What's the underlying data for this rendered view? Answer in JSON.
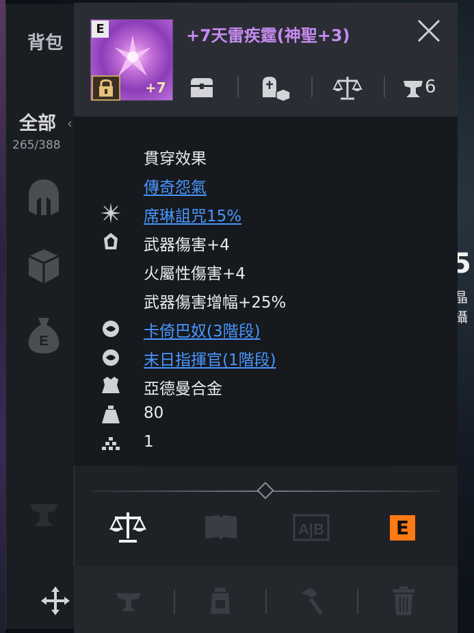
{
  "background": {
    "right_digit": "5",
    "right_text": "晶攝"
  },
  "bag": {
    "title": "背包",
    "filter_label": "全部",
    "capacity": "265/388"
  },
  "item": {
    "grade_badge": "E",
    "enhance_level": "+7",
    "name": "+7天雷疾霆(神聖+3)",
    "header_count": "6",
    "name_color": "#c78bf2"
  },
  "stats": [
    {
      "icon": "",
      "text": "貫穿效果",
      "link": false
    },
    {
      "icon": "",
      "text": "傳奇怨氣",
      "link": true
    },
    {
      "icon": "sparkle-icon",
      "text": "席琳詛咒15%",
      "link": true
    },
    {
      "icon": "crystal-icon",
      "text": "武器傷害+4",
      "link": false
    },
    {
      "icon": "",
      "text": "火屬性傷害+4",
      "link": false
    },
    {
      "icon": "",
      "text": "武器傷害增幅+25%",
      "link": false
    },
    {
      "icon": "set-icon",
      "text": "卡倚巴奴(3階段)",
      "link": true
    },
    {
      "icon": "set-icon",
      "text": "末日指揮官(1階段)",
      "link": true
    },
    {
      "icon": "material-icon",
      "text": "亞德曼合金",
      "link": false
    },
    {
      "icon": "weight-icon",
      "text": "80",
      "link": false
    },
    {
      "icon": "stack-icon",
      "text": "1",
      "link": false
    }
  ],
  "tabs": {
    "e_badge": "E"
  },
  "colors": {
    "link": "#4a97ff",
    "e_badge": "#ff7a12"
  }
}
